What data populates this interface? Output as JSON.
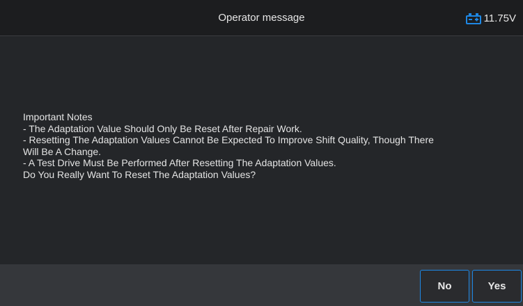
{
  "header": {
    "title": "Operator message",
    "voltage": "11.75V",
    "voltage_icon": "car-battery-icon",
    "accent_color": "#1e88e5"
  },
  "message": {
    "lines": [
      "Important Notes",
      "- The Adaptation Value Should Only Be Reset After Repair Work.",
      "- Resetting The Adaptation Values Cannot Be Expected To Improve Shift Quality, Though There",
      "Will Be A Change.",
      "- A Test Drive Must Be Performed After Resetting The Adaptation Values.",
      "Do You Really Want To Reset The Adaptation Values?"
    ]
  },
  "footer": {
    "no_label": "No",
    "yes_label": "Yes"
  }
}
